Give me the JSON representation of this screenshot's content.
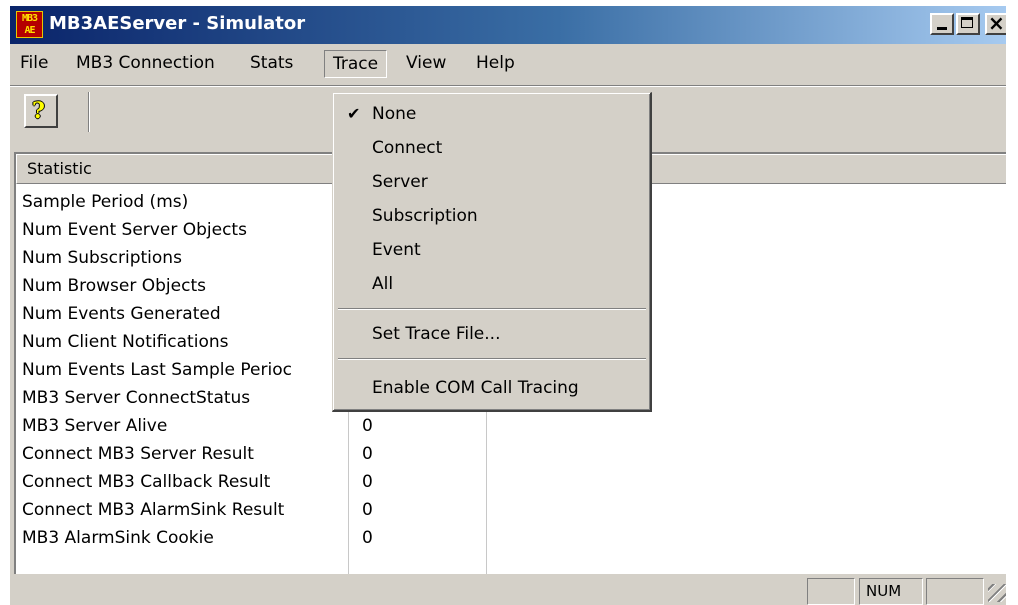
{
  "window": {
    "icon_text": "MB3\nAE",
    "title": "MB3AEServer - Simulator",
    "controls": {
      "minimize": "_",
      "maximize": "□",
      "close": "×"
    }
  },
  "menubar": {
    "items": [
      "File",
      "MB3 Connection",
      "Stats",
      "Trace",
      "View",
      "Help"
    ]
  },
  "toolbar": {
    "help_button_icon": "?",
    "help_button_icon_name": "help-icon"
  },
  "statistics": {
    "columns": [
      "Statistic",
      "",
      ""
    ],
    "rows": [
      {
        "name": "Sample Period (ms)",
        "value": ""
      },
      {
        "name": "Num Event Server Objects",
        "value": ""
      },
      {
        "name": "Num Subscriptions",
        "value": ""
      },
      {
        "name": "Num Browser Objects",
        "value": ""
      },
      {
        "name": "Num Events Generated",
        "value": ""
      },
      {
        "name": "Num Client Notifications",
        "value": ""
      },
      {
        "name": "Num Events Last Sample Perioc",
        "value": ""
      },
      {
        "name": "MB3 Server ConnectStatus",
        "value": ""
      },
      {
        "name": "MB3 Server Alive",
        "value": "0"
      },
      {
        "name": "Connect MB3 Server Result",
        "value": "0"
      },
      {
        "name": "Connect MB3 Callback Result",
        "value": "0"
      },
      {
        "name": "Connect MB3 AlarmSink Result",
        "value": "0"
      },
      {
        "name": "MB3 AlarmSink Cookie",
        "value": "0"
      }
    ]
  },
  "trace_menu": {
    "items": [
      {
        "label": "None",
        "checked": true,
        "check_mark": "✔"
      },
      {
        "label": "Connect",
        "checked": false
      },
      {
        "label": "Server",
        "checked": false
      },
      {
        "label": "Subscription",
        "checked": false
      },
      {
        "label": "Event",
        "checked": false
      },
      {
        "label": "All",
        "checked": false
      },
      {
        "label": "Set Trace File...",
        "checked": false
      },
      {
        "label": "Enable COM Call Tracing",
        "checked": false
      }
    ]
  },
  "statusbar": {
    "panes": [
      "",
      "NUM",
      ""
    ]
  },
  "colors": {
    "titlebar_start": "#0a246a",
    "titlebar_end": "#a6caf0",
    "face": "#d4d0c8",
    "window_bg": "#ffffff"
  }
}
